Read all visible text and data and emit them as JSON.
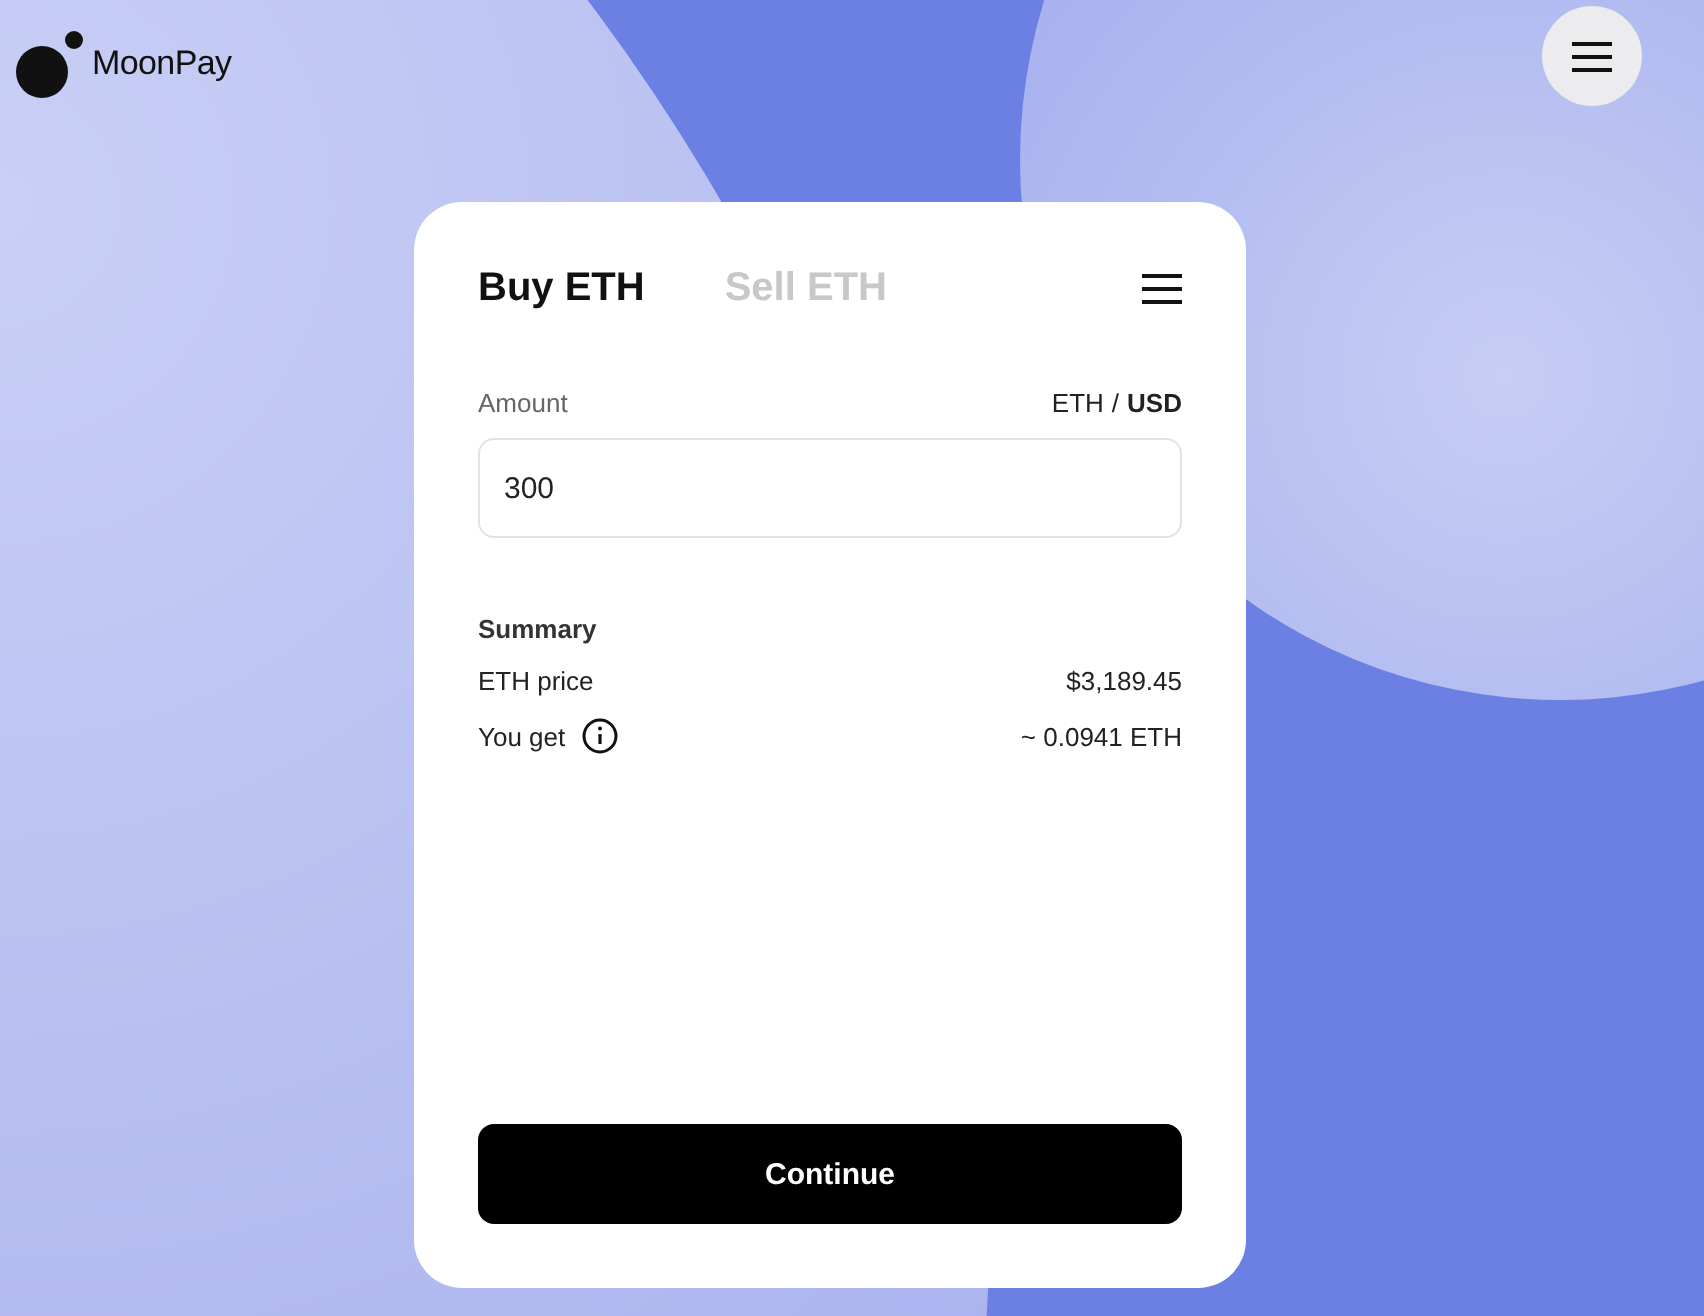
{
  "brand": {
    "name": "MoonPay"
  },
  "tabs": [
    {
      "label": "Buy ETH",
      "selected": true
    },
    {
      "label": "Sell ETH",
      "selected": false
    }
  ],
  "amount": {
    "label": "Amount",
    "value": "300",
    "currencies": [
      {
        "label": "ETH",
        "selected": false
      },
      {
        "label": "USD",
        "selected": true
      }
    ],
    "separator": "/"
  },
  "summary": {
    "title": "Summary",
    "rows": [
      {
        "label": "ETH price",
        "value": "$3,189.45",
        "info": false
      },
      {
        "label": "You get",
        "value": "~ 0.0941 ETH",
        "info": true
      }
    ]
  },
  "button": {
    "label": "Continue"
  }
}
